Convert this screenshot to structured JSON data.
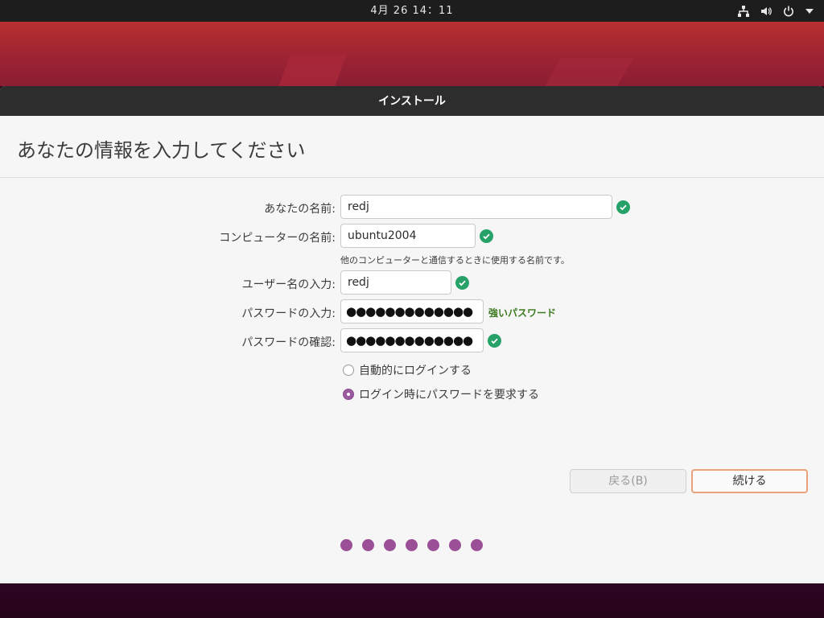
{
  "topbar": {
    "clock": "4月 26 14：11",
    "tray_icons": [
      "network-icon",
      "volume-icon",
      "power-icon",
      "chevron-down-icon"
    ]
  },
  "window": {
    "title": "インストール"
  },
  "page": {
    "heading": "あなたの情報を入力してください"
  },
  "form": {
    "name_label": "あなたの名前:",
    "name_value": "redj",
    "computer_label": "コンピューターの名前:",
    "computer_value": "ubuntu2004",
    "computer_hint": "他のコンピューターと通信するときに使用する名前です。",
    "username_label": "ユーザー名の入力:",
    "username_value": "redj",
    "password_label": "パスワードの入力:",
    "password_mask": "●●●●●●●●●●●●●",
    "password_strength": "強いパスワード",
    "confirm_label": "パスワードの確認:",
    "confirm_mask": "●●●●●●●●●●●●●",
    "login_auto_label": "自動的にログインする",
    "login_password_label": "ログイン時にパスワードを要求する",
    "login_selected": "login_password"
  },
  "buttons": {
    "back_label": "戻る(B)",
    "continue_label": "続ける"
  },
  "progress": {
    "total_steps": 7,
    "completed_steps": 7
  },
  "colors": {
    "accent": "#9b4f96",
    "check": "#26a269",
    "strength_text": "#3b7a1e",
    "continue_border": "#e9a27c"
  }
}
